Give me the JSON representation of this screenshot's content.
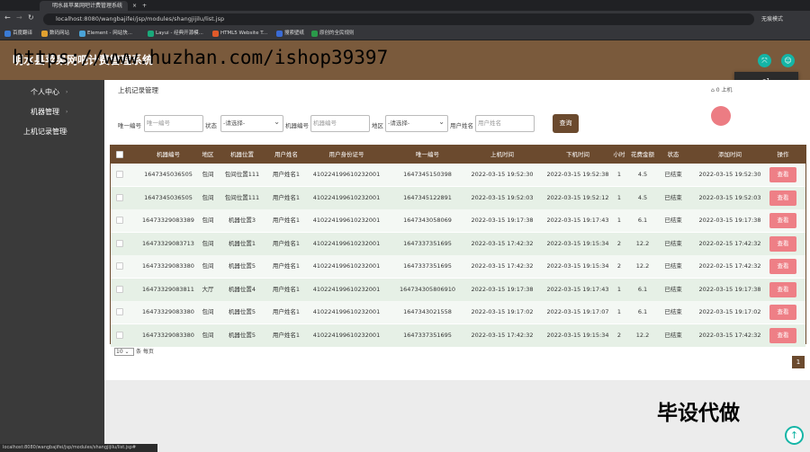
{
  "browser": {
    "tabs": [
      {
        "label": "明水县苹果网吧计费管理系统",
        "active": true
      },
      {
        "label": "",
        "active": false
      }
    ],
    "url": "localhost:8080/wangbajifei/jsp/modules/shangjijilu/list.jsp",
    "profile_label": "无痕模式",
    "bookmarks": [
      "百度翻译",
      "数码网站",
      "Element - 网站快...",
      "Layui - 经典开源模...",
      "HTML5 Website T...",
      "搜索壁纸",
      "原创的全民规则"
    ]
  },
  "app": {
    "title": "明水县苹果网吧计费管理系统",
    "user_name": "a1",
    "logout_label": "退出"
  },
  "sidebar": {
    "items": [
      {
        "label": "个人中心"
      },
      {
        "label": "机器管理"
      },
      {
        "label": "上机记录管理"
      }
    ]
  },
  "page": {
    "title": "上机记录管理",
    "breadcrumb": "⌂ 0 上机"
  },
  "filters": {
    "unique_label": "唯一编号",
    "unique_placeholder": "唯一编号",
    "status_label": "状态",
    "status_value": "-请选择-",
    "machine_label": "机器编号",
    "machine_placeholder": "机器编号",
    "area_label": "地区",
    "area_value": "-请选择-",
    "username_label": "用户姓名",
    "username_placeholder": "用户姓名",
    "search_label": "查询"
  },
  "table": {
    "headers": [
      "机器编号",
      "地区",
      "机器位置",
      "用户姓名",
      "用户身份证号",
      "唯一编号",
      "上机时间",
      "下机时间",
      "小时",
      "花费金额",
      "状态",
      "添加时间",
      "操作"
    ],
    "view_label": "查看",
    "rows": [
      [
        "1647345036505",
        "包间",
        "包间位置111",
        "用户姓名1",
        "410224199610232001",
        "1647345150398",
        "2022-03-15 19:52:30",
        "2022-03-15 19:52:38",
        "1",
        "4.5",
        "已结束",
        "2022-03-15 19:52:30"
      ],
      [
        "1647345036505",
        "包间",
        "包间位置111",
        "用户姓名1",
        "410224199610232001",
        "1647345122891",
        "2022-03-15 19:52:03",
        "2022-03-15 19:52:12",
        "1",
        "4.5",
        "已结束",
        "2022-03-15 19:52:03"
      ],
      [
        "16473329083389",
        "包间",
        "机器位置3",
        "用户姓名1",
        "410224199610232001",
        "1647343058069",
        "2022-03-15 19:17:38",
        "2022-03-15 19:17:43",
        "1",
        "6.1",
        "已结束",
        "2022-03-15 19:17:38"
      ],
      [
        "16473329083713",
        "包间",
        "机器位置1",
        "用户姓名1",
        "410224199610232001",
        "1647337351695",
        "2022-03-15 17:42:32",
        "2022-03-15 19:15:34",
        "2",
        "12.2",
        "已结束",
        "2022-02-15 17:42:32"
      ],
      [
        "16473329083380",
        "包间",
        "机器位置5",
        "用户姓名1",
        "410224199610232001",
        "1647337351695",
        "2022-03-15 17:42:32",
        "2022-03-15 19:15:34",
        "2",
        "12.2",
        "已结束",
        "2022-02-15 17:42:32"
      ],
      [
        "16473329083811",
        "大厅",
        "机器位置4",
        "用户姓名1",
        "410224199610232001",
        "1647343058069​10",
        "2022-03-15 19:17:38",
        "2022-03-15 19:17:43",
        "1",
        "6.1",
        "已结束",
        "2022-03-15 19:17:38"
      ],
      [
        "16473329083380",
        "包间",
        "机器位置5",
        "用户姓名1",
        "410224199610232001",
        "1647343021558",
        "2022-03-15 19:17:02",
        "2022-03-15 19:17:07",
        "1",
        "6.1",
        "已结束",
        "2022-03-15 19:17:02"
      ],
      [
        "16473329083380",
        "包间",
        "机器位置5",
        "用户姓名1",
        "410224199610232001",
        "1647337351695",
        "2022-03-15 17:42:32",
        "2022-03-15 19:15:34",
        "2",
        "12.2",
        "已结束",
        "2022-03-15 17:42:32"
      ]
    ]
  },
  "pagination": {
    "page_size": "10",
    "page_size_suffix": "条 每页",
    "current_page": "1"
  },
  "overlay": {
    "watermark": "https://www.huzhan.com/ishop39397",
    "promo": "毕设代做"
  },
  "statusbar": "localhost:8080/wangbajifei/jsp/modules/shangjijilu/list.jsp#"
}
